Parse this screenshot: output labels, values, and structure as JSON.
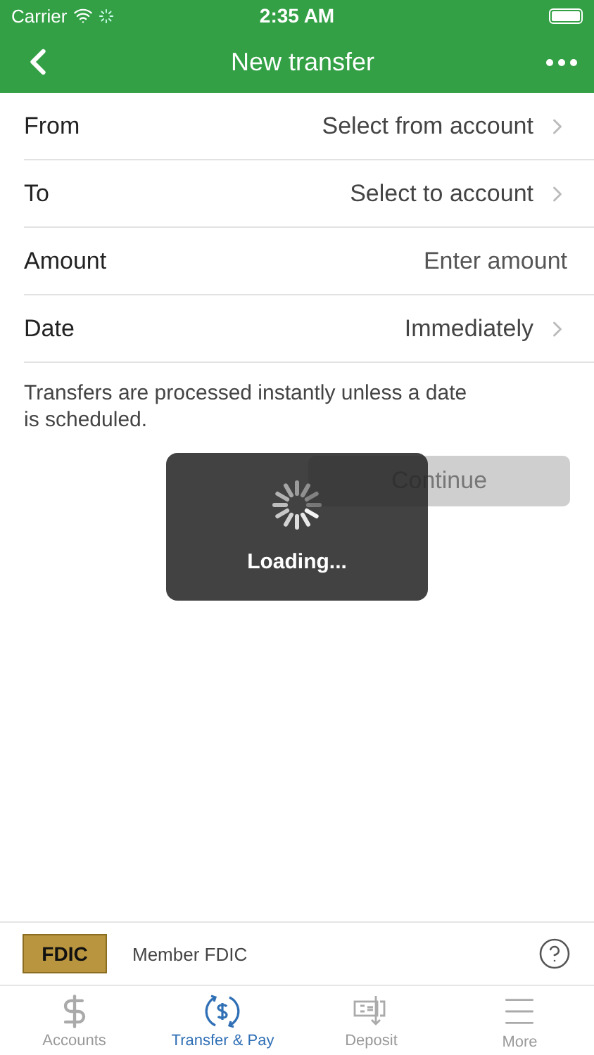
{
  "status_bar": {
    "carrier": "Carrier",
    "time": "2:35 AM"
  },
  "nav": {
    "title": "New transfer"
  },
  "fields": [
    {
      "label": "From",
      "value": "Select from account",
      "kind": "select"
    },
    {
      "label": "To",
      "value": "Select to account",
      "kind": "select"
    },
    {
      "label": "Amount",
      "placeholder": "Enter amount",
      "kind": "input"
    },
    {
      "label": "Date",
      "value": "Immediately",
      "kind": "select"
    }
  ],
  "note": "Transfers are processed instantly unless a date is scheduled.",
  "continue_button": {
    "label": "Continue",
    "disabled": true
  },
  "loading": {
    "text": "Loading..."
  },
  "footer": {
    "logo_text": "FDIC",
    "member": "Member FDIC"
  },
  "tabs": [
    {
      "label": "Accounts",
      "kind": "accounts",
      "selected": false
    },
    {
      "label": "Transfer & Pay",
      "kind": "transfer",
      "selected": true
    },
    {
      "label": "Deposit",
      "kind": "deposit",
      "selected": false
    },
    {
      "label": "More",
      "kind": "more",
      "selected": false
    }
  ]
}
